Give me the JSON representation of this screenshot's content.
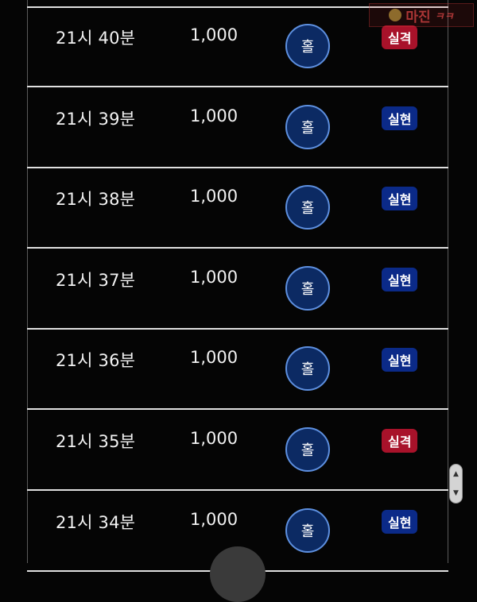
{
  "colors": {
    "pick_bg": "#0c2a63",
    "pick_border": "#5d8fdf",
    "win_badge": "#0b2a88",
    "loss_badge": "#a8122a"
  },
  "watermark": {
    "text": "마진",
    "mark": "ㅋㅋ",
    "seal_icon": "seal-icon"
  },
  "scroll_handle_icons": [
    "chevron-up-icon",
    "chevron-down-icon"
  ],
  "rows": [
    {
      "time": "21시 40분",
      "amount": "1,000",
      "pick": "홀",
      "result": "실격",
      "result_type": "loss"
    },
    {
      "time": "21시 39분",
      "amount": "1,000",
      "pick": "홀",
      "result": "실현",
      "result_type": "win"
    },
    {
      "time": "21시 38분",
      "amount": "1,000",
      "pick": "홀",
      "result": "실현",
      "result_type": "win"
    },
    {
      "time": "21시 37분",
      "amount": "1,000",
      "pick": "홀",
      "result": "실현",
      "result_type": "win"
    },
    {
      "time": "21시 36분",
      "amount": "1,000",
      "pick": "홀",
      "result": "실현",
      "result_type": "win"
    },
    {
      "time": "21시 35분",
      "amount": "1,000",
      "pick": "홀",
      "result": "실격",
      "result_type": "loss"
    },
    {
      "time": "21시 34분",
      "amount": "1,000",
      "pick": "홀",
      "result": "실현",
      "result_type": "win"
    }
  ]
}
